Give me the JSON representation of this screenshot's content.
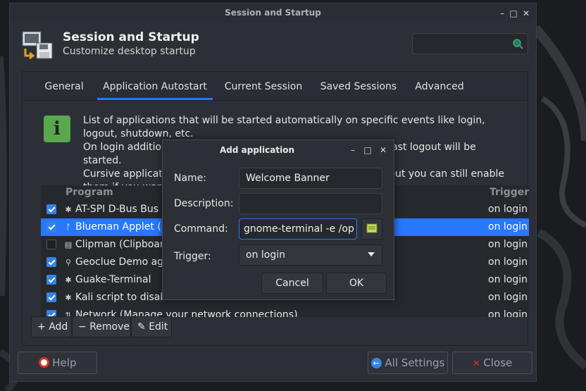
{
  "window": {
    "title": "Session and Startup",
    "header_title": "Session and Startup",
    "header_subtitle": "Customize desktop startup",
    "search_icon": "search-icon"
  },
  "tabs": [
    {
      "label": "General",
      "active": false
    },
    {
      "label": "Application Autostart",
      "active": true
    },
    {
      "label": "Current Session",
      "active": false
    },
    {
      "label": "Saved Sessions",
      "active": false
    },
    {
      "label": "Advanced",
      "active": false
    }
  ],
  "info": {
    "lines": [
      "List of applications that will be started automatically on specific events like login, logout, shutdown, etc.",
      "On login additionally all applications that were saved on your last logout will be started.",
      "Cursive applications belong to another desktop environment, but you can still enable them if you want."
    ]
  },
  "table": {
    "headers": {
      "program": "Program",
      "trigger": "Trigger"
    },
    "rows": [
      {
        "name": "AT-SPI D-Bus Bus",
        "trigger": "on login",
        "enabled": true,
        "selected": false,
        "icon": "app-icon"
      },
      {
        "name": "Blueman Applet (Blueman Bluetooth Manager)",
        "trigger": "on login",
        "enabled": true,
        "selected": true,
        "icon": "bluetooth-icon"
      },
      {
        "name": "Clipman (Clipboard manager)",
        "trigger": "on login",
        "enabled": false,
        "selected": false,
        "icon": "clipboard-icon"
      },
      {
        "name": "Geoclue Demo agent",
        "trigger": "on login",
        "enabled": true,
        "selected": false,
        "icon": "location-icon"
      },
      {
        "name": "Guake-Terminal",
        "trigger": "on login",
        "enabled": true,
        "selected": false,
        "icon": "app-icon"
      },
      {
        "name": "Kali script to disable auto-mount",
        "trigger": "on login",
        "enabled": true,
        "selected": false,
        "icon": "app-icon"
      },
      {
        "name": "Network (Manage your network connections)",
        "trigger": "on login",
        "enabled": true,
        "selected": false,
        "icon": "network-icon"
      }
    ]
  },
  "toolbar": {
    "add_label": "Add",
    "remove_label": "Remove",
    "edit_label": "Edit"
  },
  "footer": {
    "help_label": "Help",
    "all_settings_label": "All Settings",
    "close_label": "Close"
  },
  "dialog": {
    "title": "Add application",
    "name_label": "Name:",
    "name_value": "Welcome Banner",
    "description_label": "Description:",
    "description_value": "",
    "command_label": "Command:",
    "command_value": "gnome-terminal -e /op",
    "trigger_label": "Trigger:",
    "trigger_value": "on login",
    "cancel_label": "Cancel",
    "ok_label": "OK"
  },
  "colors": {
    "accent": "#2777ff",
    "info_green": "#59a84d",
    "close_red": "#e0302b"
  }
}
